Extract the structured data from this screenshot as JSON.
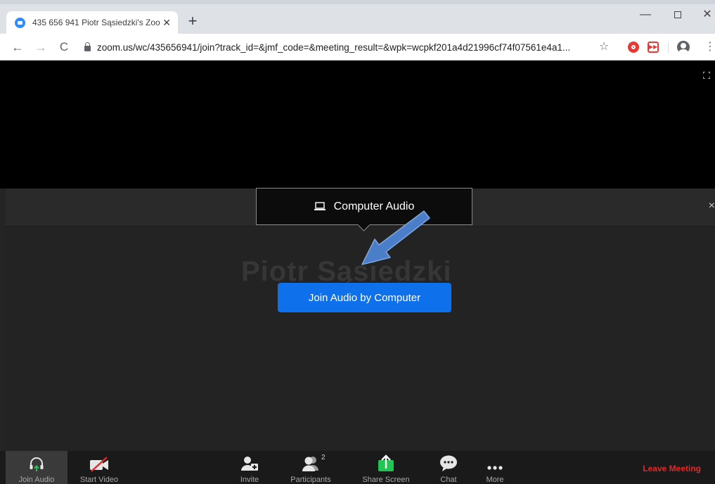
{
  "browser": {
    "tab_title": "435 656 941 Piotr Sąsiedzki's Zoo",
    "tab_close": "✕",
    "new_tab": "+",
    "nav_back": "←",
    "nav_forward": "→",
    "nav_reload": "C",
    "url": "zoom.us/wc/435656941/join?track_id=&jmf_code=&meeting_result=&wpk=wcpkf201a4d21996cf74f07561e4a1...",
    "star": "☆",
    "menu": "⋮",
    "window_minimize": "—",
    "window_close": "✕"
  },
  "meeting": {
    "audio_tab_label": "Computer Audio",
    "join_button_label": "Join Audio by Computer",
    "participant_name": "Piotr Sąsiedzki",
    "band_close": "×"
  },
  "controls": {
    "join_audio": "Join Audio",
    "start_video": "Start Video",
    "invite": "Invite",
    "participants": "Participants",
    "participants_count": "2",
    "share_screen": "Share Screen",
    "chat": "Chat",
    "more": "More",
    "leave_meeting": "Leave Meeting"
  },
  "colors": {
    "join_button": "#0e71eb",
    "share_green": "#23c552",
    "leave_red": "#e02828",
    "annotation_arrow": "#4a7ec8"
  },
  "icons": {
    "favicon": "zoom-favicon-icon",
    "lock": "lock-icon",
    "extension_1": "stop-extension-icon",
    "extension_2": "fast-forward-extension-icon",
    "profile": "profile-icon",
    "fullscreen": "fullscreen-icon",
    "audio_tab": "laptop-icon",
    "join_audio": "headphones-icon",
    "start_video": "video-off-icon",
    "invite": "add-person-icon",
    "participants": "participants-icon",
    "share_screen": "share-screen-icon",
    "chat": "chat-bubble-icon",
    "more": "more-dots-icon",
    "annotation": "arrow-annotation-icon"
  }
}
